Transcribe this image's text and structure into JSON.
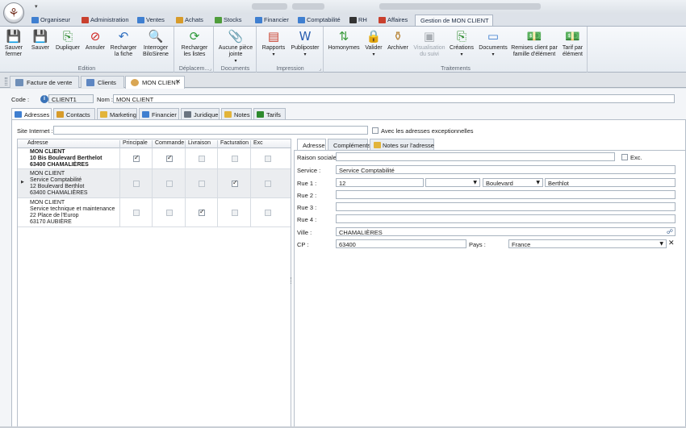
{
  "ribbon_tabs": [
    {
      "label": "Organiseur",
      "color": "#3f7fd0"
    },
    {
      "label": "Administration",
      "color": "#c9402e"
    },
    {
      "label": "Ventes",
      "color": "#3f7fd0"
    },
    {
      "label": "Achats",
      "color": "#d79b2a"
    },
    {
      "label": "Stocks",
      "color": "#4f9d3b"
    },
    {
      "label": "Financier",
      "color": "#3f7fd0"
    },
    {
      "label": "Comptabilité",
      "color": "#3f7fd0"
    },
    {
      "label": "RH",
      "color": "#333333"
    },
    {
      "label": "Affaires",
      "color": "#c9402e"
    },
    {
      "label": "Gestion de MON CLIENT",
      "color": ""
    }
  ],
  "ribbon": {
    "groups": [
      {
        "label": "Edition",
        "buttons": [
          {
            "label": "Sauver fermer",
            "icon": "save-close-icon",
            "glyph": "💾",
            "color": "#2f5fa8"
          },
          {
            "label": "Sauver",
            "icon": "save-icon",
            "glyph": "💾",
            "color": "#2f5fa8"
          },
          {
            "label": "Dupliquer",
            "icon": "duplicate-icon",
            "glyph": "⎘",
            "color": "#2e8a2e"
          },
          {
            "label": "Annuler",
            "icon": "cancel-icon",
            "glyph": "⊘",
            "color": "#d0241f"
          },
          {
            "label": "Recharger la fiche",
            "icon": "reload-undo-icon",
            "glyph": "↶",
            "color": "#2f6fc0"
          },
          {
            "label": "Interroger BiloSirene",
            "icon": "search-magnifier-icon",
            "glyph": "🔍",
            "color": "#3d6fb0"
          }
        ]
      },
      {
        "label": "Déplacem...",
        "buttons": [
          {
            "label": "Recharger les listes",
            "icon": "refresh-icon",
            "glyph": "⟳",
            "color": "#2e9a3a"
          }
        ]
      },
      {
        "label": "Documents",
        "buttons": [
          {
            "label": "Aucune pièce jointe",
            "icon": "paperclip-icon",
            "glyph": "📎",
            "color": "#6a7480"
          }
        ]
      },
      {
        "label": "Impression",
        "buttons": [
          {
            "label": "Rapports",
            "icon": "reports-icon",
            "glyph": "▤",
            "color": "#c9402e"
          },
          {
            "label": "Publiposter",
            "icon": "word-icon",
            "glyph": "W",
            "color": "#2b5fb0"
          }
        ]
      },
      {
        "label": "Traitements",
        "buttons": [
          {
            "label": "Homonymes",
            "icon": "homonyms-icon",
            "glyph": "⇅",
            "color": "#3a9a3a"
          },
          {
            "label": "Valider",
            "icon": "lock-icon",
            "glyph": "🔒",
            "color": "#d9a51f"
          },
          {
            "label": "Archiver",
            "icon": "stamp-icon",
            "glyph": "⚱",
            "color": "#b8863a"
          },
          {
            "label": "Visualisation du suivi",
            "icon": "tracking-icon",
            "glyph": "▣",
            "color": "#a7acb2"
          },
          {
            "label": "Créations",
            "icon": "create-document-icon",
            "glyph": "⎘",
            "color": "#2e8a2e"
          },
          {
            "label": "Documents",
            "icon": "documents-scroll-icon",
            "glyph": "▭",
            "color": "#3f7fd0"
          },
          {
            "label": "Remises client par famille d'élément",
            "icon": "discount-money-icon",
            "glyph": "💵",
            "color": "#2e8a2e"
          },
          {
            "label": "Tarif par élément",
            "icon": "price-money-icon",
            "glyph": "💵",
            "color": "#2e8a2e"
          }
        ]
      }
    ]
  },
  "doc_tabs": [
    {
      "label": "Facture de vente"
    },
    {
      "label": "Clients"
    },
    {
      "label": "MON CLIENT"
    }
  ],
  "header": {
    "code_label": "Code :",
    "code_value": "CLIENT1",
    "nom_label": "Nom :",
    "nom_value": "MON CLIENT"
  },
  "sub_tabs": [
    {
      "label": "Adresses",
      "color": "#3f7fd0"
    },
    {
      "label": "Contacts",
      "color": "#d79b2a"
    },
    {
      "label": "Marketing",
      "color": "#e2b43a"
    },
    {
      "label": "Financier",
      "color": "#3f7fd0"
    },
    {
      "label": "Juridique",
      "color": "#6a7480"
    },
    {
      "label": "Notes",
      "color": "#e2b43a"
    },
    {
      "label": "Tarifs",
      "color": "#2e8a2e"
    }
  ],
  "site": {
    "label": "Site Internet :",
    "value": "",
    "exceptional_label": "Avec les adresses exceptionnelles"
  },
  "grid": {
    "columns": [
      "Adresse",
      "Principale",
      "Commande",
      "Livraison",
      "Facturation",
      "Exc"
    ],
    "rows": [
      {
        "lines": [
          "MON CLIENT",
          "10 Bis Boulevard Berthelot",
          "63400 CHAMALIÈRES"
        ],
        "principale": true,
        "commande": true,
        "livraison": false,
        "facturation": false,
        "exc": false
      },
      {
        "lines": [
          "MON CLIENT",
          "Service Comptabilité",
          "12 Boulevard Berthlot",
          "63400 CHAMALIÈRES"
        ],
        "principale": false,
        "commande": false,
        "livraison": false,
        "facturation": true,
        "exc": false
      },
      {
        "lines": [
          "MON CLIENT",
          "Service technique et maintenance",
          "22 Place de l'Europ",
          "63170 AUBIÈRE"
        ],
        "principale": false,
        "commande": false,
        "livraison": true,
        "facturation": false,
        "exc": false
      }
    ]
  },
  "detail": {
    "tabs": [
      "Adresse",
      "Compléments",
      "Notes sur l'adresse"
    ],
    "raison_sociale_label": "Raison sociale :",
    "raison_sociale_value": "",
    "exc_label": "Exc.",
    "service_label": "Service :",
    "service_value": "Service Comptabilité",
    "rue1_label": "Rue 1 :",
    "rue1_number": "12",
    "rue1_suffix": "",
    "rue1_type": "Boulevard",
    "rue1_name": "Berthlot",
    "rue2_label": "Rue 2 :",
    "rue2_value": "",
    "rue3_label": "Rue 3 :",
    "rue3_value": "",
    "rue4_label": "Rue 4 :",
    "rue4_value": "",
    "ville_label": "Ville :",
    "ville_value": "CHAMALIÈRES",
    "cp_label": "CP :",
    "cp_value": "63400",
    "pays_label": "Pays :",
    "pays_value": "France"
  }
}
